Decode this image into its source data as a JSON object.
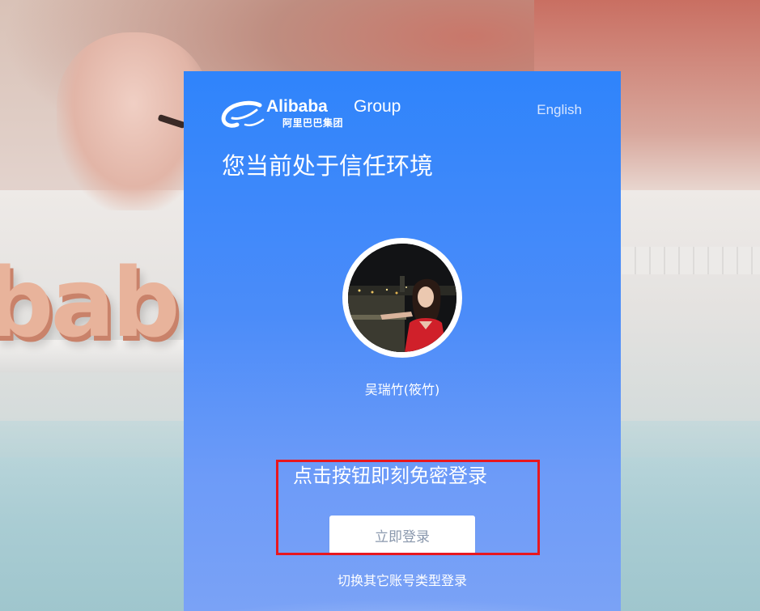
{
  "brand": {
    "name": "Alibaba",
    "group": "Group",
    "chinese": "阿里巴巴集团"
  },
  "header": {
    "language_link": "English"
  },
  "main": {
    "title": "您当前处于信任环境",
    "user_name": "吴瑞竹(筱竹)",
    "prompt": "点击按钮即刻免密登录",
    "login_button": "立即登录",
    "switch_link": "切换其它账号类型登录"
  },
  "background": {
    "letters": "bab"
  },
  "colors": {
    "panel_top": "#2f84fb",
    "panel_bottom": "#7aa2f6",
    "highlight": "#e8171f",
    "button_text": "#8a98ad"
  },
  "icons": {
    "logo": "alibaba-logo-icon",
    "avatar": "user-avatar-photo"
  }
}
